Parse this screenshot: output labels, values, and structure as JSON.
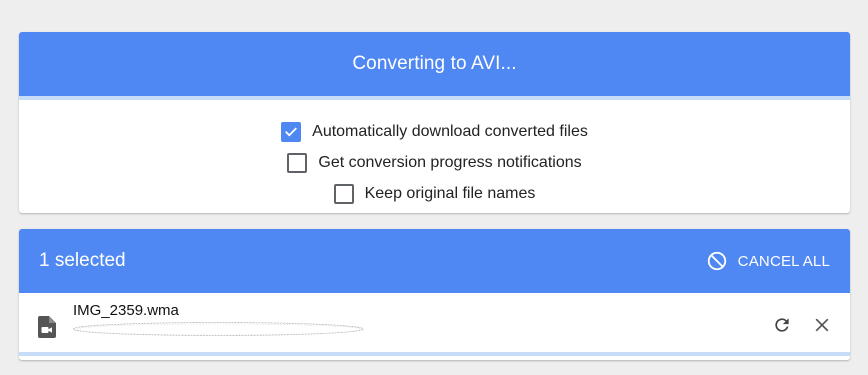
{
  "converter": {
    "title": "Converting to AVI...",
    "options": [
      {
        "label": "Automatically download converted files",
        "checked": true
      },
      {
        "label": "Get conversion progress notifications",
        "checked": false
      },
      {
        "label": "Keep original file names",
        "checked": false
      }
    ]
  },
  "files": {
    "selected_label": "1 selected",
    "cancel_all_label": "CANCEL ALL",
    "items": [
      {
        "name": "IMG_2359.wma",
        "icon": "video-file-icon"
      }
    ]
  },
  "colors": {
    "accent": "#4f87f3",
    "progress_track": "#c7dcf7",
    "background": "#eeeeee"
  },
  "icons": {
    "cancel_all": "ban-icon",
    "retry": "refresh-icon",
    "remove": "close-icon",
    "checkbox_checked": "check-icon"
  }
}
